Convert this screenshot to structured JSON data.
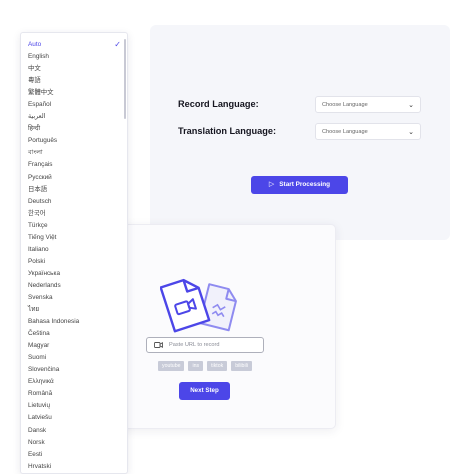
{
  "languages": {
    "items": [
      "Auto",
      "English",
      "中文",
      "粵語",
      "繁體中文",
      "Español",
      "العربية",
      "हिन्दी",
      "Português",
      "বাংলা",
      "Français",
      "Русский",
      "日本語",
      "Deutsch",
      "한국어",
      "Türkçe",
      "Tiếng Việt",
      "Italiano",
      "Polski",
      "Українська",
      "Nederlands",
      "Svenska",
      "ไทย",
      "Bahasa Indonesia",
      "Čeština",
      "Magyar",
      "Suomi",
      "Slovenčina",
      "Ελληνικά",
      "Română",
      "Lietuvių",
      "Latviešu",
      "Dansk",
      "Norsk",
      "Eesti",
      "Hrvatski"
    ],
    "selected": "Auto",
    "check_icon": "checkmark-icon"
  },
  "settings": {
    "record_label": "Record  Language:",
    "translation_label": "Translation Language:",
    "record_select": "Choose Language",
    "translation_select": "Choose Language",
    "start_button": "Start Processing"
  },
  "url_panel": {
    "placeholder": "Paste URL to record",
    "chips": [
      "youtube",
      "ins",
      "tiktok",
      "bilibili"
    ],
    "next_button": "Next Step"
  },
  "colors": {
    "accent": "#4c46e8",
    "card_bg": "#f5f6fa"
  }
}
